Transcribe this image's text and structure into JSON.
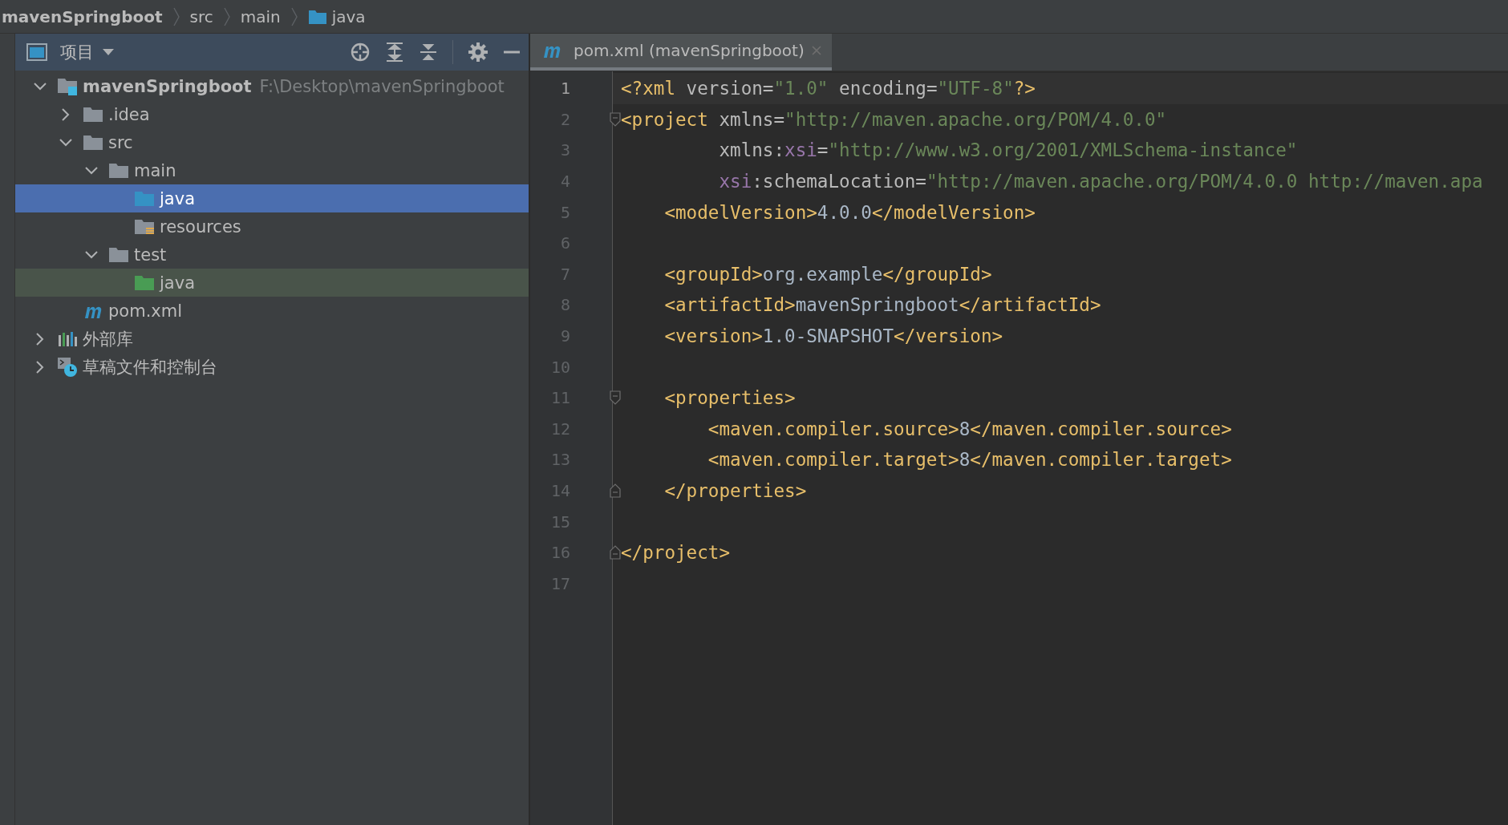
{
  "breadcrumb": [
    {
      "label": "mavenSpringboot",
      "kind": "project"
    },
    {
      "label": "src",
      "kind": "folder"
    },
    {
      "label": "main",
      "kind": "folder"
    },
    {
      "label": "java",
      "kind": "source-folder"
    }
  ],
  "project_panel": {
    "title": "项目",
    "toolbar": [
      {
        "kind": "locate"
      },
      {
        "kind": "expand"
      },
      {
        "kind": "collapse"
      },
      {
        "kind": "settings"
      },
      {
        "kind": "hide"
      }
    ]
  },
  "tree": {
    "items": [
      {
        "label": "mavenSpringboot",
        "path": "F:\\Desktop\\mavenSpringboot",
        "kind": "module",
        "expanded": true,
        "selected": false,
        "highlighted": false,
        "children": [
          {
            "label": ".idea",
            "kind": "folder",
            "expanded": false,
            "selected": false,
            "highlighted": false
          },
          {
            "label": "src",
            "kind": "folder",
            "expanded": true,
            "selected": false,
            "highlighted": false,
            "children": [
              {
                "label": "main",
                "kind": "folder",
                "expanded": true,
                "selected": false,
                "highlighted": false,
                "children": [
                  {
                    "label": "java",
                    "kind": "source-folder",
                    "selected": true,
                    "highlighted": false
                  },
                  {
                    "label": "resources",
                    "kind": "resources-folder",
                    "selected": false,
                    "highlighted": false
                  }
                ]
              },
              {
                "label": "test",
                "kind": "folder",
                "expanded": true,
                "selected": false,
                "highlighted": false,
                "children": [
                  {
                    "label": "java",
                    "kind": "test-folder",
                    "selected": false,
                    "highlighted": true
                  }
                ]
              }
            ]
          },
          {
            "label": "pom.xml",
            "kind": "maven",
            "selected": false,
            "highlighted": false
          }
        ]
      },
      {
        "label": "外部库",
        "kind": "library",
        "expanded": false,
        "selected": false,
        "highlighted": false
      },
      {
        "label": "草稿文件和控制台",
        "kind": "scratch",
        "expanded": false,
        "selected": false,
        "highlighted": false
      }
    ]
  },
  "editor": {
    "tabs": [
      {
        "label": "pom.xml (mavenSpringboot)",
        "selected": true
      }
    ],
    "lines": [
      {
        "number": "1",
        "current": true,
        "tokens": [
          {
            "kind": "tag",
            "t": "<?xml"
          },
          {
            "kind": "attr",
            "t": " version"
          },
          {
            "kind": "attr",
            "t": "="
          },
          {
            "kind": "value",
            "t": "\"1.0\""
          },
          {
            "kind": "attr",
            "t": " encoding"
          },
          {
            "kind": "attr",
            "t": "="
          },
          {
            "kind": "value",
            "t": "\"UTF-8\""
          },
          {
            "kind": "tag",
            "t": "?>"
          }
        ]
      },
      {
        "number": "2",
        "current": false,
        "fold": {
          "kind": "start"
        },
        "tokens": [
          {
            "kind": "tag",
            "t": "<project"
          },
          {
            "kind": "attr",
            "t": " xmlns"
          },
          {
            "kind": "attr",
            "t": "="
          },
          {
            "kind": "value",
            "t": "\"http://maven.apache.org/POM/4.0.0\""
          }
        ]
      },
      {
        "number": "3",
        "current": false,
        "tokens": [
          {
            "kind": "attr",
            "t": "         xmlns:"
          },
          {
            "kind": "ns",
            "t": "xsi"
          },
          {
            "kind": "attr",
            "t": "="
          },
          {
            "kind": "value",
            "t": "\"http://www.w3.org/2001/XMLSchema-instance\""
          }
        ]
      },
      {
        "number": "4",
        "current": false,
        "tokens": [
          {
            "kind": "ns",
            "t": "         xsi"
          },
          {
            "kind": "attr",
            "t": ":schemaLocation="
          },
          {
            "kind": "value",
            "t": "\"http://maven.apache.org/POM/4.0.0 http://maven.apa"
          }
        ]
      },
      {
        "number": "5",
        "current": false,
        "tokens": [
          {
            "kind": "tag",
            "t": "    <modelVersion>"
          },
          {
            "kind": "text",
            "t": "4.0.0"
          },
          {
            "kind": "tag",
            "t": "</modelVersion>"
          }
        ]
      },
      {
        "number": "6",
        "current": false
      },
      {
        "number": "7",
        "current": false,
        "tokens": [
          {
            "kind": "tag",
            "t": "    <groupId>"
          },
          {
            "kind": "text",
            "t": "org.example"
          },
          {
            "kind": "tag",
            "t": "</groupId>"
          }
        ]
      },
      {
        "number": "8",
        "current": false,
        "tokens": [
          {
            "kind": "tag",
            "t": "    <artifactId>"
          },
          {
            "kind": "text",
            "t": "mavenSpringboot"
          },
          {
            "kind": "tag",
            "t": "</artifactId>"
          }
        ]
      },
      {
        "number": "9",
        "current": false,
        "tokens": [
          {
            "kind": "tag",
            "t": "    <version>"
          },
          {
            "kind": "text",
            "t": "1.0-SNAPSHOT"
          },
          {
            "kind": "tag",
            "t": "</version>"
          }
        ]
      },
      {
        "number": "10",
        "current": false
      },
      {
        "number": "11",
        "current": false,
        "fold": {
          "kind": "start"
        },
        "tokens": [
          {
            "kind": "tag",
            "t": "    <properties>"
          }
        ]
      },
      {
        "number": "12",
        "current": false,
        "tokens": [
          {
            "kind": "tag",
            "t": "        <maven.compiler.source>"
          },
          {
            "kind": "text",
            "t": "8"
          },
          {
            "kind": "tag",
            "t": "</maven.compiler.source>"
          }
        ]
      },
      {
        "number": "13",
        "current": false,
        "tokens": [
          {
            "kind": "tag",
            "t": "        <maven.compiler.target>"
          },
          {
            "kind": "text",
            "t": "8"
          },
          {
            "kind": "tag",
            "t": "</maven.compiler.target>"
          }
        ]
      },
      {
        "number": "14",
        "current": false,
        "fold": {
          "kind": "end"
        },
        "tokens": [
          {
            "kind": "tag",
            "t": "    </properties>"
          }
        ]
      },
      {
        "number": "15",
        "current": false
      },
      {
        "number": "16",
        "current": false,
        "fold": {
          "kind": "end"
        },
        "tokens": [
          {
            "kind": "tag",
            "t": "</project>"
          }
        ]
      },
      {
        "number": "17",
        "current": false
      }
    ]
  }
}
